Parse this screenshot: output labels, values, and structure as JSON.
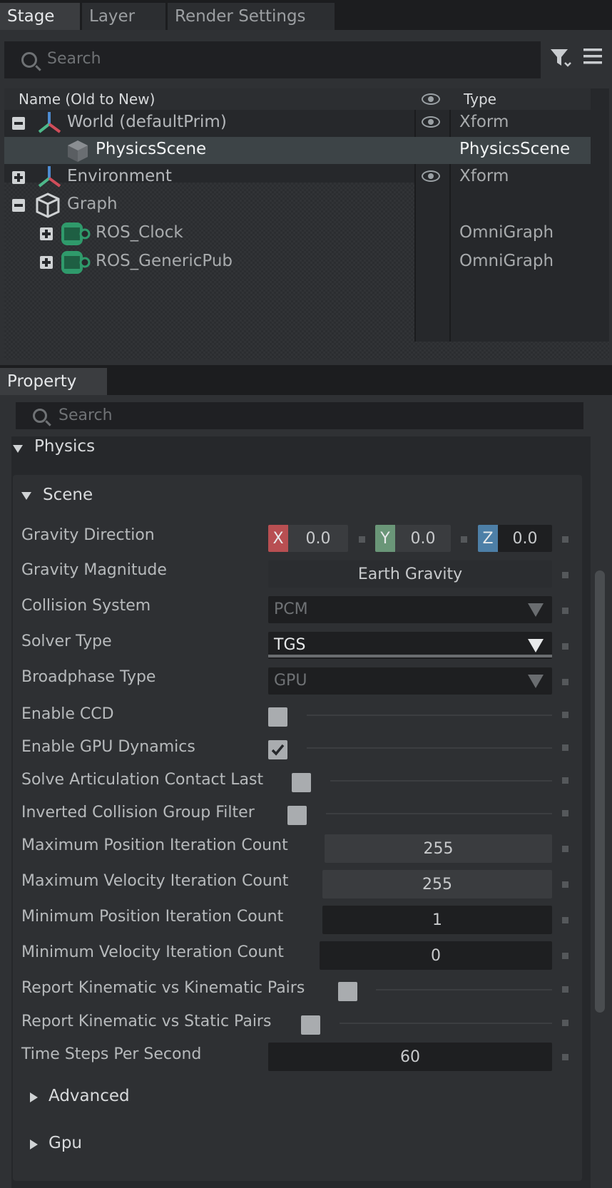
{
  "colors": {
    "axis_x": "#b84f52",
    "axis_y": "#6a9678",
    "axis_z": "#4d7fa7",
    "graph_green": "#2f9a6b",
    "selected_row": "#3d4447"
  },
  "stage_tabs": [
    {
      "label": "Stage",
      "active": true
    },
    {
      "label": "Layer",
      "active": false
    },
    {
      "label": "Render Settings",
      "active": false
    }
  ],
  "stage_search": {
    "placeholder": "Search"
  },
  "stage_columns": {
    "name": "Name (Old to New)",
    "type": "Type"
  },
  "stage_rows": [
    {
      "name": "World (defaultPrim)",
      "type": "Xform",
      "icon": "xform-axes-icon",
      "expander": "collapse",
      "visible": true
    },
    {
      "name": "PhysicsScene",
      "type": "PhysicsScene",
      "icon": "cube-icon",
      "selected": true
    },
    {
      "name": "Environment",
      "type": "Xform",
      "icon": "xform-axes-icon",
      "expander": "expand",
      "visible": true
    },
    {
      "name": "Graph",
      "type": "",
      "icon": "box-icon",
      "expander": "collapse"
    },
    {
      "name": "ROS_Clock",
      "type": "OmniGraph",
      "icon": "omnigraph-icon",
      "expander": "expand"
    },
    {
      "name": "ROS_GenericPub",
      "type": "OmniGraph",
      "icon": "omnigraph-icon",
      "expander": "expand"
    }
  ],
  "property_tab": "Property",
  "property_search": {
    "placeholder": "Search"
  },
  "physics_section": "Physics",
  "scene_section": "Scene",
  "props": {
    "gravity_direction": {
      "label": "Gravity Direction",
      "x_axis": "X",
      "y_axis": "Y",
      "z_axis": "Z",
      "x": "0.0",
      "y": "0.0",
      "z": "0.0"
    },
    "gravity_magnitude": {
      "label": "Gravity Magnitude",
      "value": "Earth Gravity"
    },
    "collision_system": {
      "label": "Collision System",
      "value": "PCM"
    },
    "solver_type": {
      "label": "Solver Type",
      "value": "TGS"
    },
    "broadphase_type": {
      "label": "Broadphase Type",
      "value": "GPU"
    },
    "enable_ccd": {
      "label": "Enable CCD",
      "checked": false
    },
    "enable_gpu_dynamics": {
      "label": "Enable GPU Dynamics",
      "checked": true
    },
    "solve_articulation_contact_last": {
      "label": "Solve Articulation Contact Last",
      "checked": false
    },
    "inverted_collision_group_filter": {
      "label": "Inverted Collision Group Filter",
      "checked": false
    },
    "max_position_iteration_count": {
      "label": "Maximum Position Iteration Count",
      "value": "255"
    },
    "max_velocity_iteration_count": {
      "label": "Maximum Velocity Iteration Count",
      "value": "255"
    },
    "min_position_iteration_count": {
      "label": "Minimum Position Iteration Count",
      "value": "1"
    },
    "min_velocity_iteration_count": {
      "label": "Minimum Velocity Iteration Count",
      "value": "0"
    },
    "report_kinematic_kinematic_pairs": {
      "label": "Report Kinematic vs Kinematic Pairs",
      "checked": false
    },
    "report_kinematic_static_pairs": {
      "label": "Report Kinematic vs Static Pairs",
      "checked": false
    },
    "time_steps_per_second": {
      "label": "Time Steps Per Second",
      "value": "60"
    }
  },
  "subsections": {
    "advanced": "Advanced",
    "gpu": "Gpu"
  }
}
